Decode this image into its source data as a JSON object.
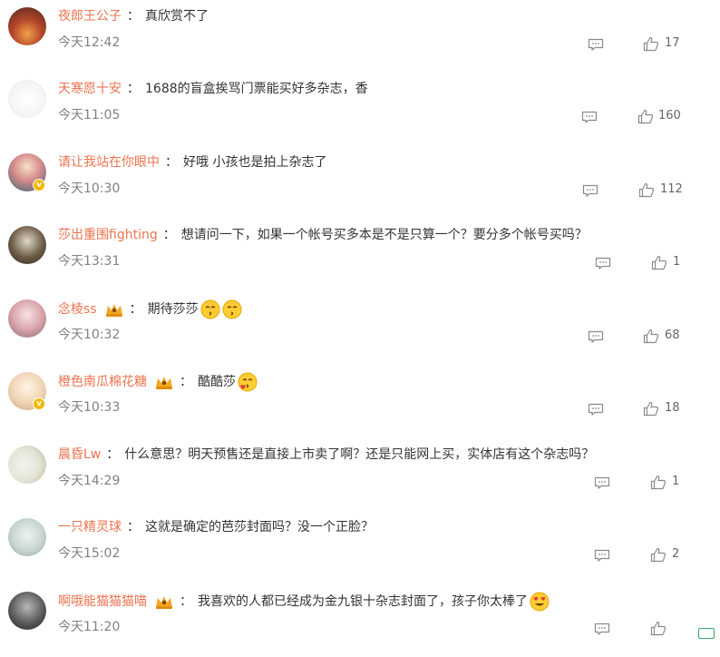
{
  "comments": [
    {
      "user": "夜郎王公子",
      "text": "真欣赏不了",
      "time": "今天12:42",
      "likes": "17",
      "crown": false,
      "vip": false,
      "emojis": []
    },
    {
      "user": "天寒愿十安",
      "text": "1688的盲盒挨骂门票能买好多杂志，香",
      "time": "今天11:05",
      "likes": "160",
      "crown": false,
      "vip": false,
      "emojis": []
    },
    {
      "user": "请让我站在你眼中",
      "text": "好哦 小孩也是拍上杂志了",
      "time": "今天10:30",
      "likes": "112",
      "crown": false,
      "vip": true,
      "emojis": []
    },
    {
      "user": "莎出重围fighting",
      "text": "想请问一下，如果一个帐号买多本是不是只算一个？要分多个帐号买吗？",
      "time": "今天13:31",
      "likes": "1",
      "crown": false,
      "vip": false,
      "emojis": []
    },
    {
      "user": "念棱ss",
      "text": "期待莎莎",
      "time": "今天10:32",
      "likes": "68",
      "crown": true,
      "vip": false,
      "emojis": [
        "kiss-emoji",
        "kiss-emoji"
      ]
    },
    {
      "user": "橙色南瓜棉花糖",
      "text": "酷酷莎",
      "time": "今天10:33",
      "likes": "18",
      "crown": true,
      "vip": true,
      "emojis": [
        "heart-kiss-emoji"
      ]
    },
    {
      "user": "晨昏Lw",
      "text": "什么意思？明天预售还是直接上市卖了啊？还是只能网上买，实体店有这个杂志吗？",
      "time": "今天14:29",
      "likes": "1",
      "crown": false,
      "vip": false,
      "emojis": []
    },
    {
      "user": "一只精灵球",
      "text": "这就是确定的芭莎封面吗？没一个正脸？",
      "time": "今天15:02",
      "likes": "2",
      "crown": false,
      "vip": false,
      "emojis": []
    },
    {
      "user": "啊哦能猫猫猫喵",
      "text": "我喜欢的人都已经成为金九银十杂志封面了，孩子你太棒了",
      "time": "今天11:20",
      "likes": "",
      "crown": true,
      "vip": false,
      "emojis": [
        "heart-eyes-emoji"
      ]
    }
  ],
  "colors": {
    "username": "#eb7350",
    "text": "#333333",
    "meta": "#808080",
    "badge": "#f6b700"
  }
}
